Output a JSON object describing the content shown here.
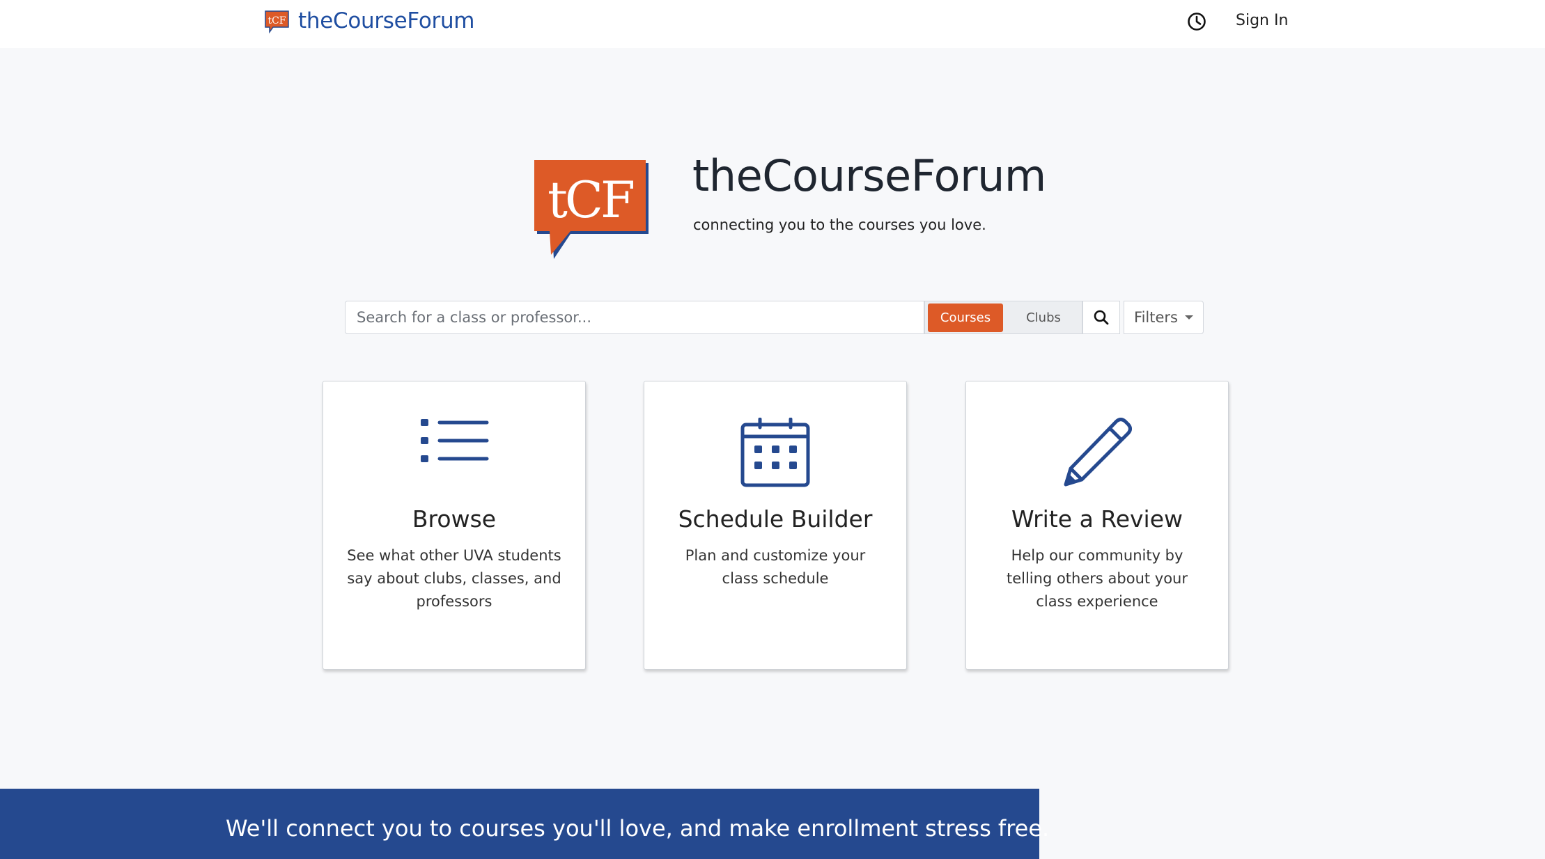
{
  "nav": {
    "brand_logo_text": "tCF",
    "brand_name": "theCourseForum",
    "history_icon": "clock-icon",
    "signin_label": "Sign In"
  },
  "hero": {
    "logo_text": "tCF",
    "title": "theCourseForum",
    "subtitle": "connecting you to the courses you love."
  },
  "search": {
    "placeholder": "Search for a class or professor...",
    "value": "",
    "mode_options": [
      "Courses",
      "Clubs"
    ],
    "selected_mode": "Courses",
    "search_icon": "search-icon",
    "filters_label": "Filters"
  },
  "cards": [
    {
      "icon": "list-icon",
      "title": "Browse",
      "description": "See what other UVA students say about clubs, classes, and professors"
    },
    {
      "icon": "calendar-icon",
      "title": "Schedule Builder",
      "description": "Plan and customize your class schedule"
    },
    {
      "icon": "pencil-icon",
      "title": "Write a Review",
      "description": "Help our community by telling others about your class experience"
    }
  ],
  "banner": {
    "text": "We'll connect you to courses you'll love, and make enrollment stress free."
  },
  "colors": {
    "brand_orange": "#dd5a27",
    "brand_blue": "#25498f",
    "page_bg": "#f7f8fa"
  }
}
